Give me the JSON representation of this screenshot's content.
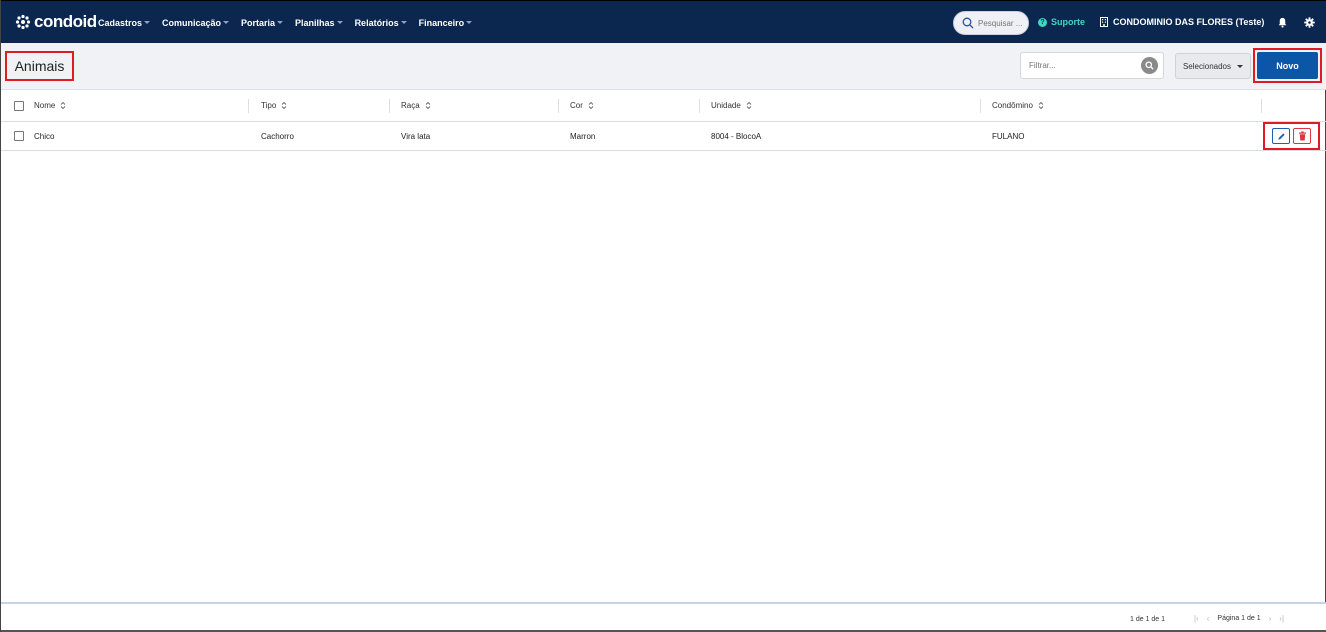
{
  "navbar": {
    "logo_text": "condoid",
    "menu": [
      {
        "label": "Cadastros"
      },
      {
        "label": "Comunicação"
      },
      {
        "label": "Portaria"
      },
      {
        "label": "Planilhas"
      },
      {
        "label": "Relatórios"
      },
      {
        "label": "Financeiro"
      }
    ],
    "search_placeholder": "Pesquisar ...",
    "suporte_label": "Suporte",
    "condominio_label": "CONDOMINIO DAS FLORES (Teste)"
  },
  "header": {
    "title": "Animais",
    "filter_placeholder": "Filtrar...",
    "selecionados_label": "Selecionados",
    "novo_label": "Novo"
  },
  "table": {
    "columns": [
      "Nome",
      "Tipo",
      "Raça",
      "Cor",
      "Unidade",
      "Condômino"
    ],
    "rows": [
      {
        "nome": "Chico",
        "tipo": "Cachorro",
        "raca": "Vira lata",
        "cor": "Marron",
        "unidade": "8004 - BlocoA",
        "condomino": "FULANO"
      }
    ]
  },
  "footer": {
    "range": "1 de 1 de 1",
    "page_label": "Página 1 de 1"
  },
  "colors": {
    "navbar_bg": "#0b2750",
    "primary_button": "#0c56a7",
    "suporte": "#3ed6c0",
    "highlight": "#e01b24",
    "delete": "#d9363e"
  }
}
